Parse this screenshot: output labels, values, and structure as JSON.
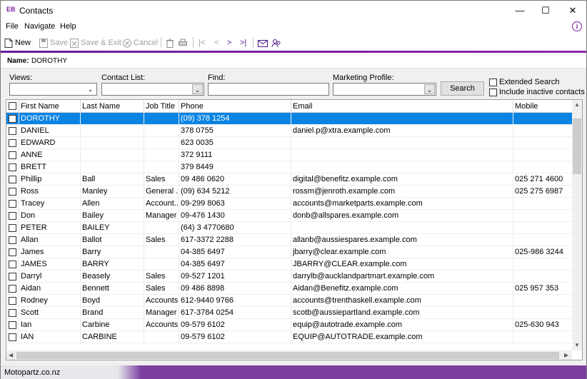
{
  "window": {
    "logo": "EB",
    "title": "Contacts",
    "minimize": "—",
    "maximize": "☐",
    "close": "✕"
  },
  "menu": {
    "file": "File",
    "navigate": "Navigate",
    "help": "Help",
    "info": "i"
  },
  "toolbar": {
    "new": "New",
    "save": "Save",
    "save_exit": "Save & Exit",
    "cancel": "Cancel",
    "first": "|<",
    "prev": "<",
    "next": ">",
    "last": ">|"
  },
  "namebar": {
    "label": "Name:",
    "value": "DOROTHY"
  },
  "filters": {
    "views_label": "Views:",
    "contact_list_label": "Contact List:",
    "find_label": "Find:",
    "find_value": "",
    "marketing_label": "Marketing Profile:",
    "search_button": "Search",
    "extended_search": "Extended Search",
    "include_inactive": "Include inactive contacts"
  },
  "grid": {
    "columns": [
      "",
      "First Name",
      "Last Name",
      "Job Title",
      "Phone",
      "Email",
      "Mobile"
    ],
    "rows": [
      {
        "first": "DOROTHY",
        "last": "",
        "job": "",
        "phone": "(09) 378 1254",
        "email": "",
        "mobile": ""
      },
      {
        "first": "DANIEL",
        "last": "",
        "job": "",
        "phone": "378 0755",
        "email": "daniel.p@xtra.example.com",
        "mobile": ""
      },
      {
        "first": "EDWARD",
        "last": "",
        "job": "",
        "phone": "623 0035",
        "email": "",
        "mobile": ""
      },
      {
        "first": "ANNE",
        "last": "",
        "job": "",
        "phone": "372 9111",
        "email": "",
        "mobile": ""
      },
      {
        "first": "BRETT",
        "last": "",
        "job": "",
        "phone": "379 8449",
        "email": "",
        "mobile": ""
      },
      {
        "first": "Phillip",
        "last": " Ball",
        "job": "Sales",
        "phone": "09 486 0620",
        "email": "digital@benefitz.example.com",
        "mobile": "025 271 4600"
      },
      {
        "first": "Ross",
        "last": " Manley",
        "job": "General ...",
        "phone": "(09) 634 5212",
        "email": "rossm@jenroth.example.com",
        "mobile": "025 275 6987"
      },
      {
        "first": "Tracey",
        "last": "Allen",
        "job": "Account...",
        "phone": "09-299 8063",
        "email": "accounts@marketparts.example.com",
        "mobile": ""
      },
      {
        "first": "Don",
        "last": "Bailey",
        "job": "Manager",
        "phone": "09-476 1430",
        "email": "donb@allspares.example.com",
        "mobile": ""
      },
      {
        "first": "PETER",
        "last": "BAILEY",
        "job": "",
        "phone": "(64) 3 4770680",
        "email": "",
        "mobile": ""
      },
      {
        "first": "Allan",
        "last": "Ballot",
        "job": "Sales",
        "phone": "617-3372 2288",
        "email": "allanb@aussiespares.example.com",
        "mobile": ""
      },
      {
        "first": "James",
        "last": "Barry",
        "job": "",
        "phone": "04-385 6497",
        "email": "jbarry@clear.example.com",
        "mobile": "025-986 3244"
      },
      {
        "first": "JAMES",
        "last": "BARRY",
        "job": "",
        "phone": "04-385 6497",
        "email": "JBARRY@CLEAR.example.com",
        "mobile": ""
      },
      {
        "first": "Darryl",
        "last": "Beasely",
        "job": "Sales",
        "phone": "09-527 1201",
        "email": "darrylb@aucklandpartmart.example.com",
        "mobile": ""
      },
      {
        "first": "Aidan",
        "last": "Bennett",
        "job": "Sales",
        "phone": "09 486 8898",
        "email": "Aidan@Benefitz.example.com",
        "mobile": "025 957 353"
      },
      {
        "first": "Rodney",
        "last": "Boyd",
        "job": "Accounts",
        "phone": "612-9440 9766",
        "email": "accounts@trenthaskell.example.com",
        "mobile": ""
      },
      {
        "first": "Scott",
        "last": "Brand",
        "job": "Manager",
        "phone": "617-3784 0254",
        "email": "scotb@aussiepartland.example.com",
        "mobile": ""
      },
      {
        "first": "Ian",
        "last": "Carbine",
        "job": "Accounts",
        "phone": "09-579 6102",
        "email": "equip@autotrade.example.com",
        "mobile": "025-630 943"
      },
      {
        "first": "IAN",
        "last": "CARBINE",
        "job": "",
        "phone": "09-579 6102",
        "email": "EQUIP@AUTOTRADE.example.com",
        "mobile": ""
      }
    ]
  },
  "status": {
    "text": "Motopartz.co.nz"
  }
}
